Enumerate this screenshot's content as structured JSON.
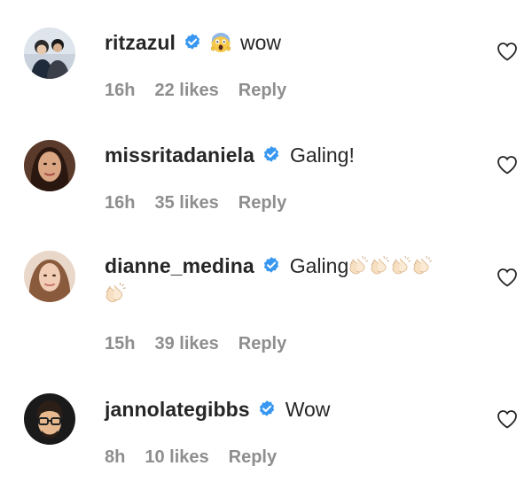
{
  "colors": {
    "text": "#262626",
    "meta": "#8e8e8e",
    "verified": "#3897f0",
    "background": "#ffffff"
  },
  "icons": {
    "verified": "verified-badge-icon",
    "like": "heart-outline-icon",
    "clap": "clapping-hands-emoji",
    "scream": "face-screaming-in-fear-emoji"
  },
  "comments": [
    {
      "username": "ritzazul",
      "emoji": "😱",
      "text": "wow",
      "time": "16h",
      "likes": "22 likes",
      "reply": "Reply"
    },
    {
      "username": "missritadaniela",
      "text": "Galing!",
      "time": "16h",
      "likes": "35 likes",
      "reply": "Reply"
    },
    {
      "username": "dianne_medina",
      "text": "Galing",
      "emoji": "👏👏👏👏👏",
      "time": "15h",
      "likes": "39 likes",
      "reply": "Reply"
    },
    {
      "username": "jannolategibbs",
      "text": "Wow",
      "time": "8h",
      "likes": "10 likes",
      "reply": "Reply"
    }
  ]
}
